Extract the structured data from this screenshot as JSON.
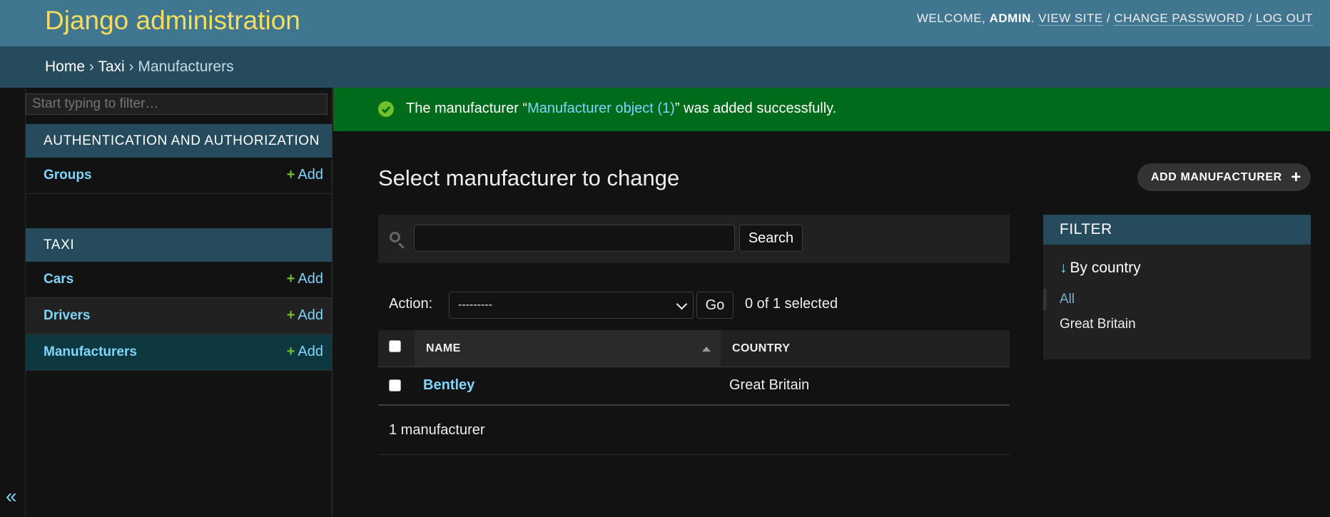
{
  "header": {
    "brand": "Django administration",
    "welcome": "WELCOME, ",
    "username": "ADMIN",
    "dot": ". ",
    "view_site": "VIEW SITE",
    "sep": " / ",
    "change_password": "CHANGE PASSWORD",
    "log_out": "LOG OUT"
  },
  "breadcrumbs": {
    "home": "Home",
    "sep": " › ",
    "app": "Taxi",
    "current": "Manufacturers"
  },
  "sidebar": {
    "filter_placeholder": "Start typing to filter…",
    "collapse": "«",
    "apps": [
      {
        "name": "AUTHENTICATION AND AUTHORIZATION",
        "models": [
          {
            "name": "Groups",
            "add": "Add"
          }
        ]
      },
      {
        "name": "TAXI",
        "models": [
          {
            "name": "Cars",
            "add": "Add"
          },
          {
            "name": "Drivers",
            "add": "Add"
          },
          {
            "name": "Manufacturers",
            "add": "Add"
          }
        ]
      }
    ],
    "add_plus": "+"
  },
  "message": {
    "prefix": "The manufacturer “",
    "object": "Manufacturer object (1)",
    "suffix": "” was added successfully."
  },
  "page": {
    "title": "Select manufacturer to change",
    "add_button": "ADD MANUFACTURER",
    "add_plus": "+"
  },
  "search": {
    "value": "",
    "button": "Search"
  },
  "actions": {
    "label": "Action:",
    "selected_option": "---------",
    "go": "Go",
    "counter": "0 of 1 selected"
  },
  "table": {
    "columns": [
      "NAME",
      "COUNTRY"
    ],
    "rows": [
      {
        "name": "Bentley",
        "country": "Great Britain"
      }
    ],
    "paginator": "1 manufacturer"
  },
  "filter": {
    "header": "FILTER",
    "arrow": "↓",
    "title": "By country",
    "options": [
      "All",
      "Great Britain"
    ]
  }
}
